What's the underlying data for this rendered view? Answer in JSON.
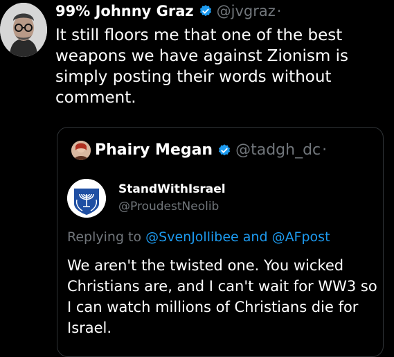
{
  "main_tweet": {
    "display_name": "99% Johnny Graz",
    "handle": "@jvgraz",
    "separator": "·",
    "avatar_icon": "person-avatar-icon",
    "verified_icon": "verified-badge-icon",
    "verified_color": "#1d9bf0",
    "text": "It still floors me that one of the best\nweapons we have against Zionism is\nsimply posting their words without\ncomment."
  },
  "quoted_tweet": {
    "display_name": "Phairy Megan",
    "handle": "@tadgh_dc",
    "separator": "·",
    "verified_icon": "verified-badge-icon",
    "screenshot": {
      "display_name": "StandWithIsrael",
      "handle": "@ProudestNeolib",
      "avatar_icon": "israel-emblem-icon",
      "replying_prefix": "Replying to",
      "mention_1": "@SvenJollibee",
      "conjunction": "and",
      "mention_2": "@AFpost",
      "text": "We aren't the twisted one. You wicked Christians are, and I can't wait for WW3 so I can watch millions of Christians die for Israel."
    }
  },
  "colors": {
    "background": "#000000",
    "text": "#ffffff",
    "muted": "#71767b",
    "accent": "#1d9bf0",
    "border": "#2f3336"
  }
}
